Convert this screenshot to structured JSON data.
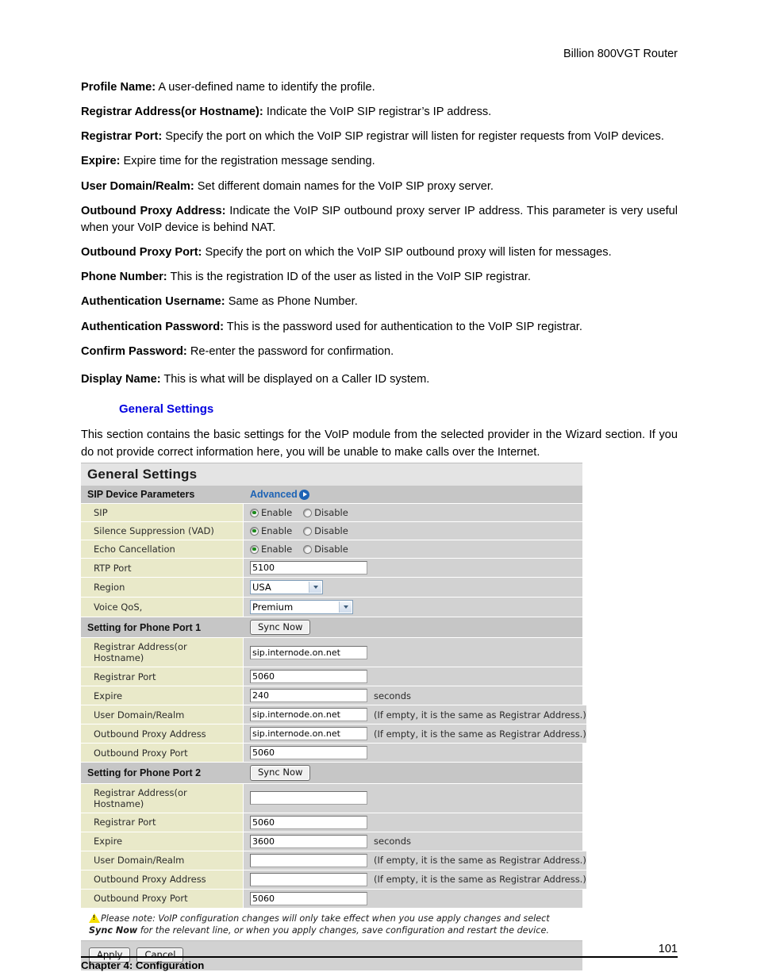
{
  "header": {
    "title": "Billion 800VGT Router"
  },
  "prose": {
    "paragraphs": [
      {
        "term": "Profile Name:",
        "text": " A user-defined name to identify the profile."
      },
      {
        "term": "Registrar Address(or Hostname):",
        "text": " Indicate the VoIP SIP registrar’s IP address."
      },
      {
        "term": "Registrar Port:",
        "text": " Specify the port on which the VoIP SIP registrar will listen for register requests from VoIP devices."
      },
      {
        "term": "Expire:",
        "text": " Expire time for the registration message sending."
      },
      {
        "term": "User Domain/Realm:",
        "text": " Set different domain names for the VoIP SIP proxy server."
      },
      {
        "term": "Outbound Proxy Address:",
        "text": " Indicate the VoIP SIP outbound proxy server IP address. This parameter is very useful when your VoIP device is behind NAT."
      },
      {
        "term": "Outbound Proxy Port:",
        "text": " Specify the port on which the VoIP SIP outbound proxy will listen for messages."
      },
      {
        "term": "Phone Number:",
        "text": " This is the registration ID of the user as listed in the VoIP SIP registrar."
      },
      {
        "term": "Authentication Username:",
        "text": " Same as Phone Number."
      },
      {
        "term": "Authentication Password:",
        "text": " This is the password used for authentication to the VoIP SIP registrar."
      },
      {
        "term": "Confirm Password:",
        "text": " Re-enter the password for confirmation."
      },
      {
        "term": "Display Name:",
        "text": " This is what will be displayed on a Caller ID system."
      }
    ],
    "subheading": "General Settings",
    "intro": "This section contains the basic settings for the VoIP module from the selected provider in the Wizard section. If you do not provide correct information here, you will be unable to make calls over   the Internet."
  },
  "ui": {
    "panel_title": "General Settings",
    "sip_device_parameters": {
      "label": "SIP Device Parameters",
      "advanced_link": "Advanced"
    },
    "radio_rows": [
      {
        "label": "SIP",
        "enable": "Enable",
        "disable": "Disable",
        "selected": "Enable"
      },
      {
        "label": "Silence Suppression (VAD)",
        "enable": "Enable",
        "disable": "Disable",
        "selected": "Enable"
      },
      {
        "label": "Echo Cancellation",
        "enable": "Enable",
        "disable": "Disable",
        "selected": "Enable"
      }
    ],
    "rtp_port": {
      "label": "RTP Port",
      "value": "5100"
    },
    "region": {
      "label": "Region",
      "value": "USA"
    },
    "voice_qos": {
      "label": "Voice QoS,",
      "value": "Premium"
    },
    "sync_now_label": "Sync Now",
    "hint_if_empty": "(If empty, it is the same as Registrar Address.)",
    "seconds_suffix": "seconds",
    "port1": {
      "section_label": "Setting for Phone Port 1",
      "fields": [
        {
          "label": "Registrar Address(or Hostname)",
          "value": "sip.internode.on.net",
          "suffix": ""
        },
        {
          "label": "Registrar Port",
          "value": "5060",
          "suffix": ""
        },
        {
          "label": "Expire",
          "value": "240",
          "suffix": "seconds"
        },
        {
          "label": "User Domain/Realm",
          "value": "sip.internode.on.net",
          "suffix": "(If empty, it is the same as Registrar Address.)"
        },
        {
          "label": "Outbound Proxy Address",
          "value": "sip.internode.on.net",
          "suffix": "(If empty, it is the same as Registrar Address.)"
        },
        {
          "label": "Outbound Proxy Port",
          "value": "5060",
          "suffix": ""
        }
      ]
    },
    "port2": {
      "section_label": "Setting for Phone Port 2",
      "fields": [
        {
          "label": "Registrar Address(or Hostname)",
          "value": "",
          "suffix": ""
        },
        {
          "label": "Registrar Port",
          "value": "5060",
          "suffix": ""
        },
        {
          "label": "Expire",
          "value": "3600",
          "suffix": "seconds"
        },
        {
          "label": "User Domain/Realm",
          "value": "",
          "suffix": "(If empty, it is the same as Registrar Address.)"
        },
        {
          "label": "Outbound Proxy Address",
          "value": "",
          "suffix": "(If empty, it is the same as Registrar Address.)"
        },
        {
          "label": "Outbound Proxy Port",
          "value": "5060",
          "suffix": ""
        }
      ]
    },
    "note": {
      "part1": "Please note: VoIP configuration changes will only take effect when you use apply changes and select ",
      "bold": "Sync Now",
      "part2": " for the relevant line, or when you apply changes, save configuration and restart the device."
    },
    "apply_label": "Apply",
    "cancel_label": "Cancel"
  },
  "footer": {
    "page_number": "101",
    "chapter": "Chapter 4: Configuration"
  },
  "colors": {
    "link_blue": "#1d63b5",
    "heading_blue": "#0000e0",
    "label_khaki": "#e9e9c9",
    "panel_gray": "#d2d2d2",
    "section_gray": "#c6c6c6",
    "radio_green": "#1a8a1a",
    "warning_yellow": "#f6e000"
  }
}
